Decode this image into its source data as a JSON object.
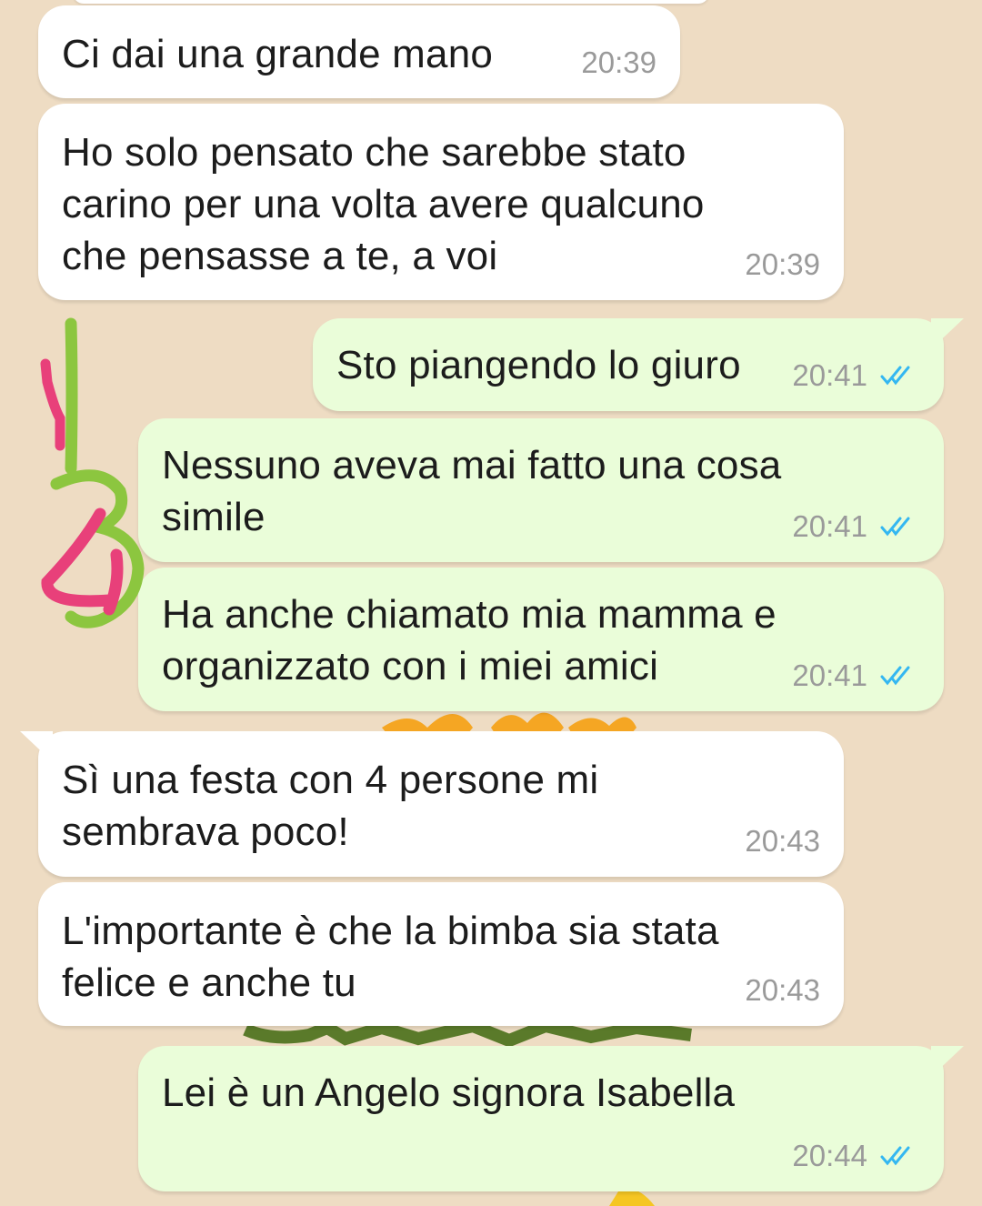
{
  "colors": {
    "wallpaper": "#eedcc3",
    "incoming_bubble": "#ffffff",
    "outgoing_bubble": "#eafdd9",
    "timestamp": "#9a9a9a",
    "read_ticks": "#34b7f1",
    "scribble_green": "#8cc63f",
    "scribble_pink": "#e8407a"
  },
  "messages": [
    {
      "direction": "incoming",
      "text": "Ci dai una grande mano",
      "time": "20:39"
    },
    {
      "direction": "incoming",
      "text": "Ho solo pensato che sarebbe stato\ncarino per una volta avere qualcuno\nche pensasse a te, a voi",
      "time": "20:39"
    },
    {
      "direction": "outgoing",
      "text": "Sto piangendo lo giuro",
      "time": "20:41",
      "status": "double-check-read-icon"
    },
    {
      "direction": "outgoing",
      "text": "Nessuno aveva mai fatto una cosa\nsimile",
      "time": "20:41",
      "status": "double-check-read-icon"
    },
    {
      "direction": "outgoing",
      "text": "Ha anche chiamato mia mamma e\norganizzato con i miei amici",
      "time": "20:41",
      "status": "double-check-read-icon"
    },
    {
      "direction": "incoming",
      "text": "Sì una festa con 4 persone mi\nsembrava poco!",
      "time": "20:43"
    },
    {
      "direction": "incoming",
      "text": "L'importante è che la bimba sia stata\nfelice e anche tu",
      "time": "20:43"
    },
    {
      "direction": "outgoing",
      "text": "Lei è un Angelo signora Isabella",
      "time": "20:44",
      "status": "double-check-read-icon"
    }
  ],
  "annotations": {
    "first_number": "1",
    "second_number": "2",
    "third_number": "3"
  }
}
